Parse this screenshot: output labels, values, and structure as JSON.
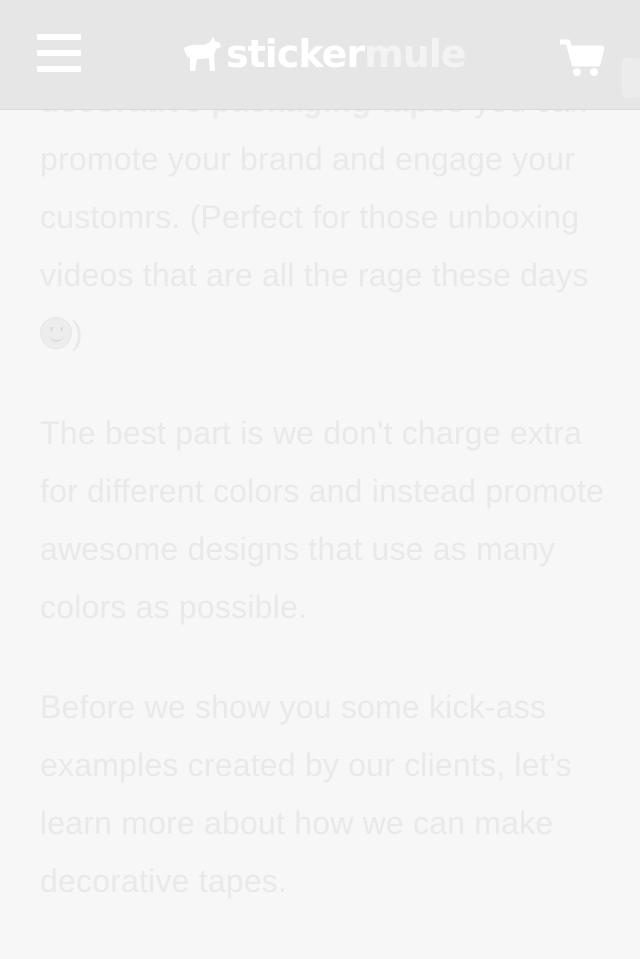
{
  "header": {
    "logo_part1": "sticker",
    "logo_part2": "mule",
    "menu_icon": "hamburger-menu-icon",
    "cart_icon": "shopping-cart-icon"
  },
  "article": {
    "partial_line_bold": "decorative packaging tapes",
    "partial_line_rest": " you",
    "p1_rest": "can promote your brand and engage your customrs. (Perfect for those unboxing videos that are all the rage these days ",
    "p1_end": ")",
    "p2": "The best part is we don't charge extra for different colors and instead promote awesome designs that use as many colors as possible.",
    "p3": "Before we show you some kick-ass examples created by our clients, let’s learn more about how we can make decorative tapes."
  },
  "colors": {
    "header_bg": "#e6e6e6",
    "text": "#e9e9e9",
    "page_bg": "#f7f7f7"
  }
}
